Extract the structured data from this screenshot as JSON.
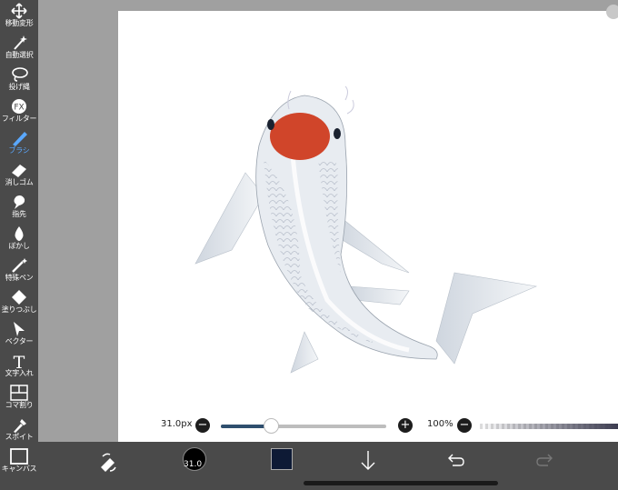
{
  "colors": {
    "sidebar": "#4a4a4a",
    "active": "#5aa8ff",
    "current_color": "#0e1a35",
    "slider_fill": "#2f4f6e"
  },
  "tools": [
    {
      "label": "移動変形",
      "icon": "move-icon"
    },
    {
      "label": "自動選択",
      "icon": "magic-wand-icon"
    },
    {
      "label": "投げ縄",
      "icon": "lasso-icon"
    },
    {
      "label": "フィルター",
      "icon": "fx-icon",
      "glyph": "FX"
    },
    {
      "label": "ブラシ",
      "icon": "brush-icon",
      "active": true
    },
    {
      "label": "消しゴム",
      "icon": "eraser-icon"
    },
    {
      "label": "指先",
      "icon": "finger-icon"
    },
    {
      "label": "ぼかし",
      "icon": "blur-drop-icon"
    },
    {
      "label": "特殊ペン",
      "icon": "special-pen-icon"
    },
    {
      "label": "塗りつぶし",
      "icon": "fill-bucket-icon"
    },
    {
      "label": "ベクター",
      "icon": "vector-arrow-icon"
    },
    {
      "label": "文字入れ",
      "icon": "text-icon",
      "glyph": "T"
    },
    {
      "label": "コマ割り",
      "icon": "frame-divide-icon"
    },
    {
      "label": "スポイト",
      "icon": "eyedropper-icon"
    },
    {
      "label": "キャンバス",
      "icon": "canvas-icon"
    }
  ],
  "brush": {
    "size_label": "31.0px",
    "size_fraction": 0.3,
    "opacity_label": "100%",
    "minus": "−",
    "plus": "+"
  },
  "bottom": {
    "brush_size_badge": "31.0"
  }
}
